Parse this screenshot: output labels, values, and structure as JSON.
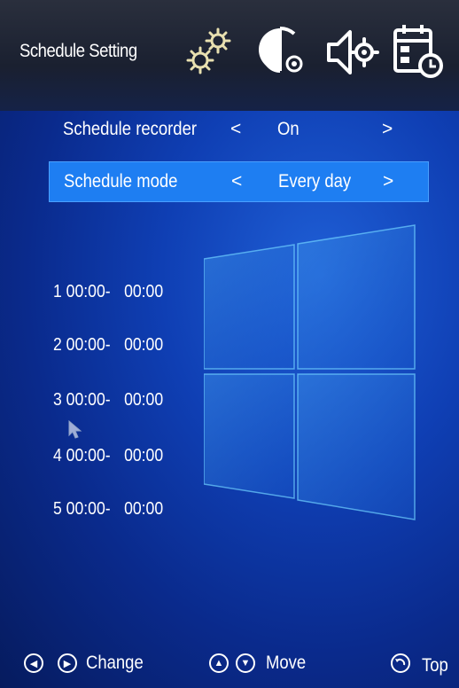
{
  "header": {
    "title": "Schedule Setting",
    "icons": [
      "system-settings-icon",
      "display-settings-icon",
      "audio-settings-icon",
      "schedule-calendar-icon"
    ]
  },
  "menu": {
    "rows": [
      {
        "label": "Schedule recorder",
        "left_arrow": "<",
        "value": "On",
        "right_arrow": ">"
      },
      {
        "label": "Schedule mode",
        "left_arrow": "<",
        "value": "Every day",
        "right_arrow": ">"
      }
    ]
  },
  "schedules": [
    {
      "index": "1",
      "start": "00:00",
      "sep": "-",
      "end": "00:00"
    },
    {
      "index": "2",
      "start": "00:00",
      "sep": "-",
      "end": "00:00"
    },
    {
      "index": "3",
      "start": "00:00",
      "sep": "-",
      "end": "00:00"
    },
    {
      "index": "4",
      "start": "00:00",
      "sep": "-",
      "end": "00:00"
    },
    {
      "index": "5",
      "start": "00:00",
      "sep": "-",
      "end": "00:00"
    }
  ],
  "footer": {
    "change_label": "Change",
    "move_label": "Move",
    "top_label": "Top"
  },
  "colors": {
    "highlight": "#1e7ef2",
    "background": "#0f3fb4"
  }
}
